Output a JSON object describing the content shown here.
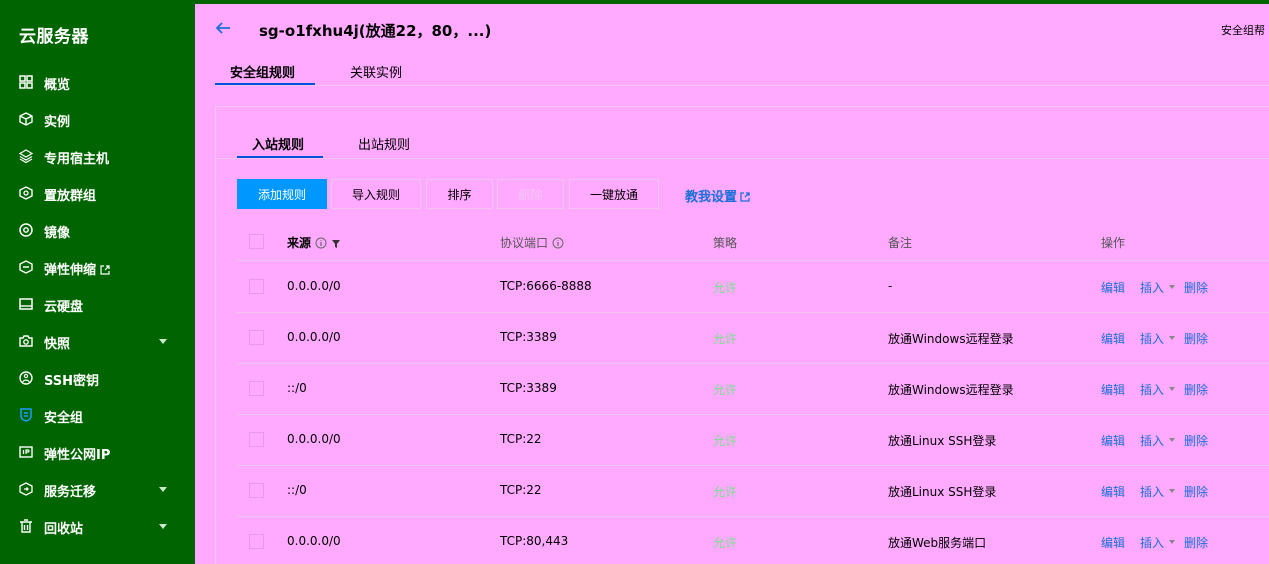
{
  "sidebar": {
    "title": "云服务器",
    "items": [
      {
        "label": "概览",
        "icon": "dashboard-icon"
      },
      {
        "label": "实例",
        "icon": "cube-icon"
      },
      {
        "label": "专用宿主机",
        "icon": "layers-icon"
      },
      {
        "label": "置放群组",
        "icon": "group-icon"
      },
      {
        "label": "镜像",
        "icon": "disc-icon"
      },
      {
        "label": "弹性伸缩",
        "icon": "scaling-icon",
        "external": true
      },
      {
        "label": "云硬盘",
        "icon": "disk-icon"
      },
      {
        "label": "快照",
        "icon": "camera-icon",
        "expandable": true
      },
      {
        "label": "SSH密钥",
        "icon": "key-icon"
      },
      {
        "label": "安全组",
        "icon": "shield-icon",
        "active": true
      },
      {
        "label": "弹性公网IP",
        "icon": "ip-icon"
      },
      {
        "label": "服务迁移",
        "icon": "migrate-icon",
        "expandable": true
      },
      {
        "label": "回收站",
        "icon": "trash-icon",
        "expandable": true
      }
    ]
  },
  "header": {
    "title": "sg-o1fxhu4j(放通22，80，...)",
    "help": "安全组帮"
  },
  "top_tabs": [
    {
      "label": "安全组规则",
      "active": true
    },
    {
      "label": "关联实例",
      "active": false
    }
  ],
  "sub_tabs": [
    {
      "label": "入站规则",
      "active": true
    },
    {
      "label": "出站规则",
      "active": false
    }
  ],
  "toolbar": {
    "add": "添加规则",
    "import": "导入规则",
    "sort": "排序",
    "delete": "删除",
    "open_all": "一键放通",
    "guide": "教我设置"
  },
  "table": {
    "headers": {
      "source": "来源",
      "port": "协议端口",
      "policy": "策略",
      "note": "备注",
      "ops": "操作"
    },
    "rows": [
      {
        "source": "0.0.0.0/0",
        "port": "TCP:6666-8888",
        "policy": "允许",
        "note": "-"
      },
      {
        "source": "0.0.0.0/0",
        "port": "TCP:3389",
        "policy": "允许",
        "note": "放通Windows远程登录"
      },
      {
        "source": "::/0",
        "port": "TCP:3389",
        "policy": "允许",
        "note": "放通Windows远程登录"
      },
      {
        "source": "0.0.0.0/0",
        "port": "TCP:22",
        "policy": "允许",
        "note": "放通Linux SSH登录"
      },
      {
        "source": "::/0",
        "port": "TCP:22",
        "policy": "允许",
        "note": "放通Linux SSH登录"
      },
      {
        "source": "0.0.0.0/0",
        "port": "TCP:80,443",
        "policy": "允许",
        "note": "放通Web服务端口"
      }
    ],
    "actions": {
      "edit": "编辑",
      "insert": "插入",
      "delete": "删除"
    }
  },
  "colors": {
    "sidebar_bg": "#006400",
    "page_bg": "#ffaaff",
    "primary": "#0098ff",
    "link": "#1b6fd9",
    "allow": "#7adf8c"
  }
}
